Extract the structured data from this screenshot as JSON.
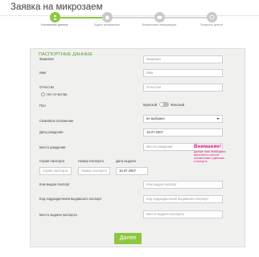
{
  "header": {
    "title": "Заявка на микрозаем"
  },
  "steps": [
    {
      "label": "Контактные данные",
      "active": true
    },
    {
      "label": "Адрес проживания",
      "active": false
    },
    {
      "label": "Финансовая информация",
      "active": false
    },
    {
      "label": "Получить деньги",
      "active": false
    }
  ],
  "section": {
    "title": "ПАСПОРТНЫЕ ДАННЫЕ"
  },
  "form": {
    "surname": {
      "label": "Фамилия",
      "placeholder": "Фамилия"
    },
    "name": {
      "label": "Имя",
      "placeholder": "Имя"
    },
    "patronymic": {
      "label": "Отчество",
      "placeholder": "Отчество"
    },
    "no_patronymic": {
      "label": "Нет отчества"
    },
    "gender": {
      "label": "Пол",
      "male": "Мужской",
      "female": "Женский"
    },
    "marital": {
      "label": "Семейное положение",
      "value": "не выбрано"
    },
    "birth_date": {
      "label": "Дата рождения",
      "value": "15.07.2007"
    },
    "birth_place": {
      "label": "Место рождения",
      "placeholder": "Место рождения"
    },
    "passport_series": {
      "label": "Серия паспорта",
      "placeholder": "Серия паспорта"
    },
    "passport_number": {
      "label": "Номер паспорта",
      "placeholder": "Номер паспорта"
    },
    "issue_date": {
      "label": "Дата выдачи",
      "value": "15.07.2007"
    },
    "issued_by": {
      "label": "Кем выдан паспорт",
      "placeholder": "Кем выдан паспорт"
    },
    "dept_code": {
      "label": "Код подразделения выдавшего паспорт",
      "placeholder": "Код подразделения выдавшего паспорт"
    },
    "issue_place": {
      "label": "Место выдачи паспорта",
      "placeholder": "Место выдачи паспорта"
    }
  },
  "warning": {
    "title": "Внимание!",
    "text": "Данные поля необходимо заполнять в строгом соответствии с данными в паспорте."
  },
  "submit": {
    "label": "Далее"
  },
  "colors": {
    "accent": "#8dc63f",
    "warning": "#d9187f",
    "panel": "#f0f0ee"
  }
}
